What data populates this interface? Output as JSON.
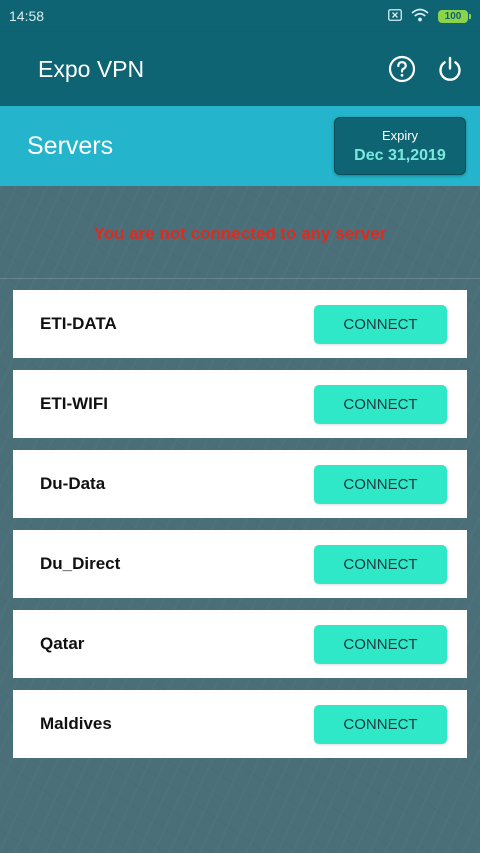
{
  "status_bar": {
    "time": "14:58",
    "battery": "100",
    "icons": [
      "sim-off-icon",
      "wifi-icon",
      "battery-icon"
    ]
  },
  "app_bar": {
    "title": "Expo VPN",
    "actions": [
      "help-icon",
      "power-icon"
    ]
  },
  "header": {
    "title": "Servers",
    "expiry_label": "Expiry",
    "expiry_date": "Dec 31,2019"
  },
  "connection_status": "You are not connected to any server",
  "servers": [
    {
      "name": "ETI-DATA",
      "action": "CONNECT"
    },
    {
      "name": "ETI-WIFI",
      "action": "CONNECT"
    },
    {
      "name": "Du-Data",
      "action": "CONNECT"
    },
    {
      "name": "Du_Direct",
      "action": "CONNECT"
    },
    {
      "name": "Qatar",
      "action": "CONNECT"
    },
    {
      "name": "Maldives",
      "action": "CONNECT"
    }
  ],
  "colors": {
    "primary": "#0e6472",
    "header_band": "#24b5cc",
    "accent": "#2ee8c8",
    "error": "#e02a1e",
    "background": "#4a6f78"
  }
}
